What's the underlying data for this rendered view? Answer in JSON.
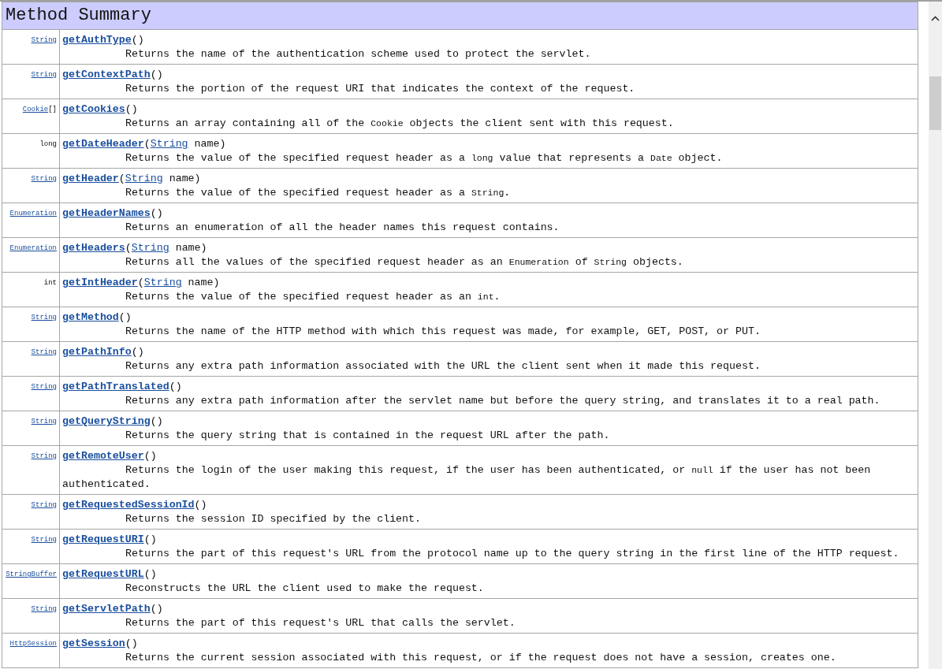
{
  "title": "Method Summary",
  "methods": [
    {
      "return": {
        "type": "String",
        "link": true
      },
      "signature": [
        {
          "kind": "method",
          "text": "getAuthType"
        },
        {
          "kind": "text",
          "text": "()"
        }
      ],
      "description": [
        {
          "kind": "text",
          "text": "Returns the name of the authentication scheme used to protect the servlet."
        }
      ]
    },
    {
      "return": {
        "type": "String",
        "link": true
      },
      "signature": [
        {
          "kind": "method",
          "text": "getContextPath"
        },
        {
          "kind": "text",
          "text": "()"
        }
      ],
      "description": [
        {
          "kind": "text",
          "text": "Returns the portion of the request URI that indicates the context of the request."
        }
      ]
    },
    {
      "return": {
        "type": "Cookie",
        "link": true,
        "suffix": "[]"
      },
      "signature": [
        {
          "kind": "method",
          "text": "getCookies"
        },
        {
          "kind": "text",
          "text": "()"
        }
      ],
      "description": [
        {
          "kind": "text",
          "text": "Returns an array containing all of the "
        },
        {
          "kind": "code",
          "text": "Cookie"
        },
        {
          "kind": "text",
          "text": " objects the client sent with this request."
        }
      ]
    },
    {
      "return": {
        "type": "long",
        "link": false
      },
      "signature": [
        {
          "kind": "method",
          "text": "getDateHeader"
        },
        {
          "kind": "text",
          "text": "("
        },
        {
          "kind": "type",
          "text": "String"
        },
        {
          "kind": "text",
          "text": " name)"
        }
      ],
      "description": [
        {
          "kind": "text",
          "text": "Returns the value of the specified request header as a "
        },
        {
          "kind": "code",
          "text": "long"
        },
        {
          "kind": "text",
          "text": " value that represents a "
        },
        {
          "kind": "code",
          "text": "Date"
        },
        {
          "kind": "text",
          "text": " object."
        }
      ]
    },
    {
      "return": {
        "type": "String",
        "link": true
      },
      "signature": [
        {
          "kind": "method",
          "text": "getHeader"
        },
        {
          "kind": "text",
          "text": "("
        },
        {
          "kind": "type",
          "text": "String"
        },
        {
          "kind": "text",
          "text": " name)"
        }
      ],
      "description": [
        {
          "kind": "text",
          "text": "Returns the value of the specified request header as a "
        },
        {
          "kind": "code",
          "text": "String"
        },
        {
          "kind": "text",
          "text": "."
        }
      ]
    },
    {
      "return": {
        "type": "Enumeration",
        "link": true
      },
      "signature": [
        {
          "kind": "method",
          "text": "getHeaderNames"
        },
        {
          "kind": "text",
          "text": "()"
        }
      ],
      "description": [
        {
          "kind": "text",
          "text": "Returns an enumeration of all the header names this request contains."
        }
      ]
    },
    {
      "return": {
        "type": "Enumeration",
        "link": true
      },
      "signature": [
        {
          "kind": "method",
          "text": "getHeaders"
        },
        {
          "kind": "text",
          "text": "("
        },
        {
          "kind": "type",
          "text": "String"
        },
        {
          "kind": "text",
          "text": " name)"
        }
      ],
      "description": [
        {
          "kind": "text",
          "text": "Returns all the values of the specified request header as an "
        },
        {
          "kind": "code",
          "text": "Enumeration"
        },
        {
          "kind": "text",
          "text": " of "
        },
        {
          "kind": "code",
          "text": "String"
        },
        {
          "kind": "text",
          "text": " objects."
        }
      ]
    },
    {
      "return": {
        "type": "int",
        "link": false
      },
      "signature": [
        {
          "kind": "method",
          "text": "getIntHeader"
        },
        {
          "kind": "text",
          "text": "("
        },
        {
          "kind": "type",
          "text": "String"
        },
        {
          "kind": "text",
          "text": " name)"
        }
      ],
      "description": [
        {
          "kind": "text",
          "text": "Returns the value of the specified request header as an "
        },
        {
          "kind": "code",
          "text": "int"
        },
        {
          "kind": "text",
          "text": "."
        }
      ]
    },
    {
      "return": {
        "type": "String",
        "link": true
      },
      "signature": [
        {
          "kind": "method",
          "text": "getMethod"
        },
        {
          "kind": "text",
          "text": "()"
        }
      ],
      "description": [
        {
          "kind": "text",
          "text": "Returns the name of the HTTP method with which this request was made, for example, GET, POST, or PUT."
        }
      ]
    },
    {
      "return": {
        "type": "String",
        "link": true
      },
      "signature": [
        {
          "kind": "method",
          "text": "getPathInfo"
        },
        {
          "kind": "text",
          "text": "()"
        }
      ],
      "description": [
        {
          "kind": "text",
          "text": "Returns any extra path information associated with the URL the client sent when it made this request."
        }
      ]
    },
    {
      "return": {
        "type": "String",
        "link": true
      },
      "signature": [
        {
          "kind": "method",
          "text": "getPathTranslated"
        },
        {
          "kind": "text",
          "text": "()"
        }
      ],
      "description": [
        {
          "kind": "text",
          "text": "Returns any extra path information after the servlet name but before the query string, and translates it to a real path."
        }
      ]
    },
    {
      "return": {
        "type": "String",
        "link": true
      },
      "signature": [
        {
          "kind": "method",
          "text": "getQueryString"
        },
        {
          "kind": "text",
          "text": "()"
        }
      ],
      "description": [
        {
          "kind": "text",
          "text": "Returns the query string that is contained in the request URL after the path."
        }
      ]
    },
    {
      "return": {
        "type": "String",
        "link": true
      },
      "signature": [
        {
          "kind": "method",
          "text": "getRemoteUser"
        },
        {
          "kind": "text",
          "text": "()"
        }
      ],
      "description": [
        {
          "kind": "text",
          "text": "Returns the login of the user making this request, if the user has been authenticated, or "
        },
        {
          "kind": "code",
          "text": "null"
        },
        {
          "kind": "text",
          "text": " if the user has not been authenticated."
        }
      ]
    },
    {
      "return": {
        "type": "String",
        "link": true
      },
      "signature": [
        {
          "kind": "method",
          "text": "getRequestedSessionId"
        },
        {
          "kind": "text",
          "text": "()"
        }
      ],
      "description": [
        {
          "kind": "text",
          "text": "Returns the session ID specified by the client."
        }
      ]
    },
    {
      "return": {
        "type": "String",
        "link": true
      },
      "signature": [
        {
          "kind": "method",
          "text": "getRequestURI"
        },
        {
          "kind": "text",
          "text": "()"
        }
      ],
      "description": [
        {
          "kind": "text",
          "text": "Returns the part of this request's URL from the protocol name up to the query string in the first line of the HTTP request."
        }
      ]
    },
    {
      "return": {
        "type": "StringBuffer",
        "link": true
      },
      "signature": [
        {
          "kind": "method",
          "text": "getRequestURL"
        },
        {
          "kind": "text",
          "text": "()"
        }
      ],
      "description": [
        {
          "kind": "text",
          "text": "Reconstructs the URL the client used to make the request."
        }
      ]
    },
    {
      "return": {
        "type": "String",
        "link": true
      },
      "signature": [
        {
          "kind": "method",
          "text": "getServletPath"
        },
        {
          "kind": "text",
          "text": "()"
        }
      ],
      "description": [
        {
          "kind": "text",
          "text": "Returns the part of this request's URL that calls the servlet."
        }
      ]
    },
    {
      "return": {
        "type": "HttpSession",
        "link": true
      },
      "signature": [
        {
          "kind": "method",
          "text": "getSession"
        },
        {
          "kind": "text",
          "text": "()"
        }
      ],
      "description": [
        {
          "kind": "text",
          "text": "Returns the current session associated with this request, or if the request does not have a session, creates one."
        }
      ]
    }
  ]
}
